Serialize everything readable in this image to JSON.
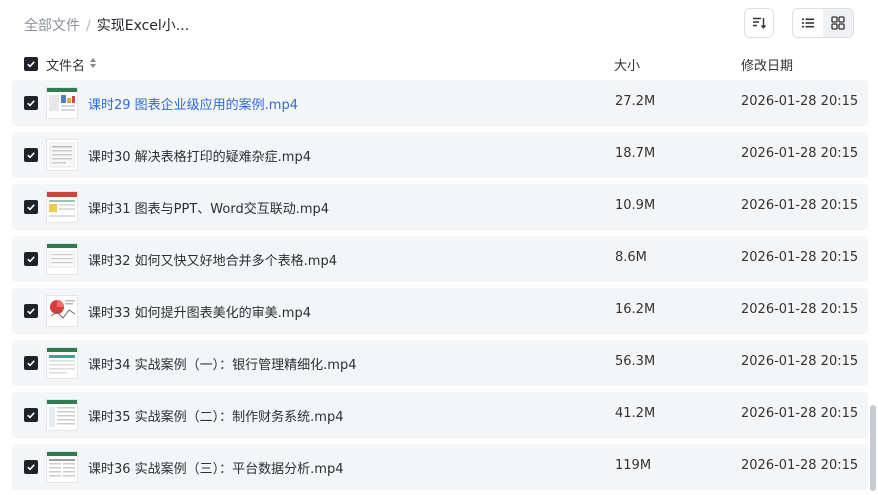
{
  "breadcrumb": {
    "root": "全部文件",
    "separator": "/",
    "current": "实现Excel小..."
  },
  "toolbar": {
    "sort_icon": "sort-icon",
    "list_view_icon": "list-icon",
    "grid_view_icon": "grid-icon",
    "active_view": "list"
  },
  "columns": {
    "name": "文件名",
    "size": "大小",
    "modified": "修改日期"
  },
  "colors": {
    "link": "#2f6bd8",
    "row_bg": "#f4f5f7",
    "checkbox": "#1f2329"
  },
  "files": [
    {
      "name": "课时29 图表企业级应用的案例.mp4",
      "size": "27.2M",
      "modified": "2026-01-28 20:15",
      "checked": true,
      "highlighted": true
    },
    {
      "name": "课时30 解决表格打印的疑难杂症.mp4",
      "size": "18.7M",
      "modified": "2026-01-28 20:15",
      "checked": true,
      "highlighted": false
    },
    {
      "name": "课时31 图表与PPT、Word交互联动.mp4",
      "size": "10.9M",
      "modified": "2026-01-28 20:15",
      "checked": true,
      "highlighted": false
    },
    {
      "name": "课时32 如何又快又好地合并多个表格.mp4",
      "size": "8.6M",
      "modified": "2026-01-28 20:15",
      "checked": true,
      "highlighted": false
    },
    {
      "name": "课时33 如何提升图表美化的审美.mp4",
      "size": "16.2M",
      "modified": "2026-01-28 20:15",
      "checked": true,
      "highlighted": false
    },
    {
      "name": "课时34 实战案例（一）：银行管理精细化.mp4",
      "size": "56.3M",
      "modified": "2026-01-28 20:15",
      "checked": true,
      "highlighted": false
    },
    {
      "name": "课时35 实战案例（二）：制作财务系统.mp4",
      "size": "41.2M",
      "modified": "2026-01-28 20:15",
      "checked": true,
      "highlighted": false
    },
    {
      "name": "课时36 实战案例（三）：平台数据分析.mp4",
      "size": "119M",
      "modified": "2026-01-28 20:15",
      "checked": true,
      "highlighted": false
    }
  ]
}
